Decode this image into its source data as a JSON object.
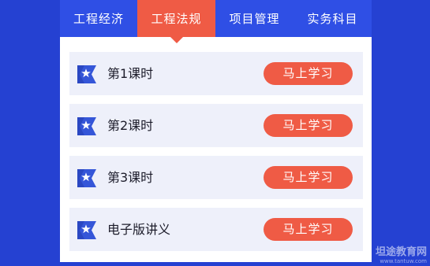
{
  "tabs": [
    {
      "label": "工程经济",
      "active": false
    },
    {
      "label": "工程法规",
      "active": true
    },
    {
      "label": "项目管理",
      "active": false
    },
    {
      "label": "实务科目",
      "active": false
    }
  ],
  "lessons": [
    {
      "title": "第1课时",
      "button": "马上学习",
      "icon": "star-bookmark-icon"
    },
    {
      "title": "第2课时",
      "button": "马上学习",
      "icon": "star-bookmark-icon"
    },
    {
      "title": "第3课时",
      "button": "马上学习",
      "icon": "star-bookmark-icon"
    },
    {
      "title": "电子版讲义",
      "button": "马上学习",
      "icon": "star-bookmark-icon"
    }
  ],
  "watermark": {
    "name": "坦途教育网",
    "url": "www.tantuw.com"
  },
  "colors": {
    "background": "#2541d2",
    "tab_bar": "#2f4fe5",
    "accent": "#ef5b45",
    "row_bg": "#eef0fa",
    "icon_blue": "#3556d8"
  }
}
